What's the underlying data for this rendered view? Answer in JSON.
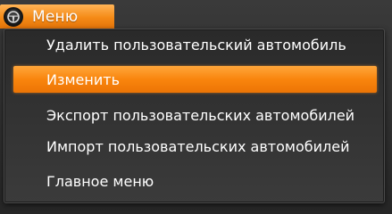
{
  "menu_tab": {
    "label": "Меню",
    "icon": "steering-wheel-icon",
    "accent_color": "#f58a16"
  },
  "dropdown": {
    "items": [
      {
        "label": "Удалить пользовательский автомобиль",
        "selected": false
      },
      {
        "label": "Изменить",
        "selected": true
      },
      {
        "label": "Экспорт пользовательских автомобилей",
        "selected": false
      },
      {
        "label": "Импорт пользовательских автомобилей",
        "selected": false
      },
      {
        "label": "Главное меню",
        "selected": false
      }
    ],
    "highlight_color": "#f9850d"
  }
}
